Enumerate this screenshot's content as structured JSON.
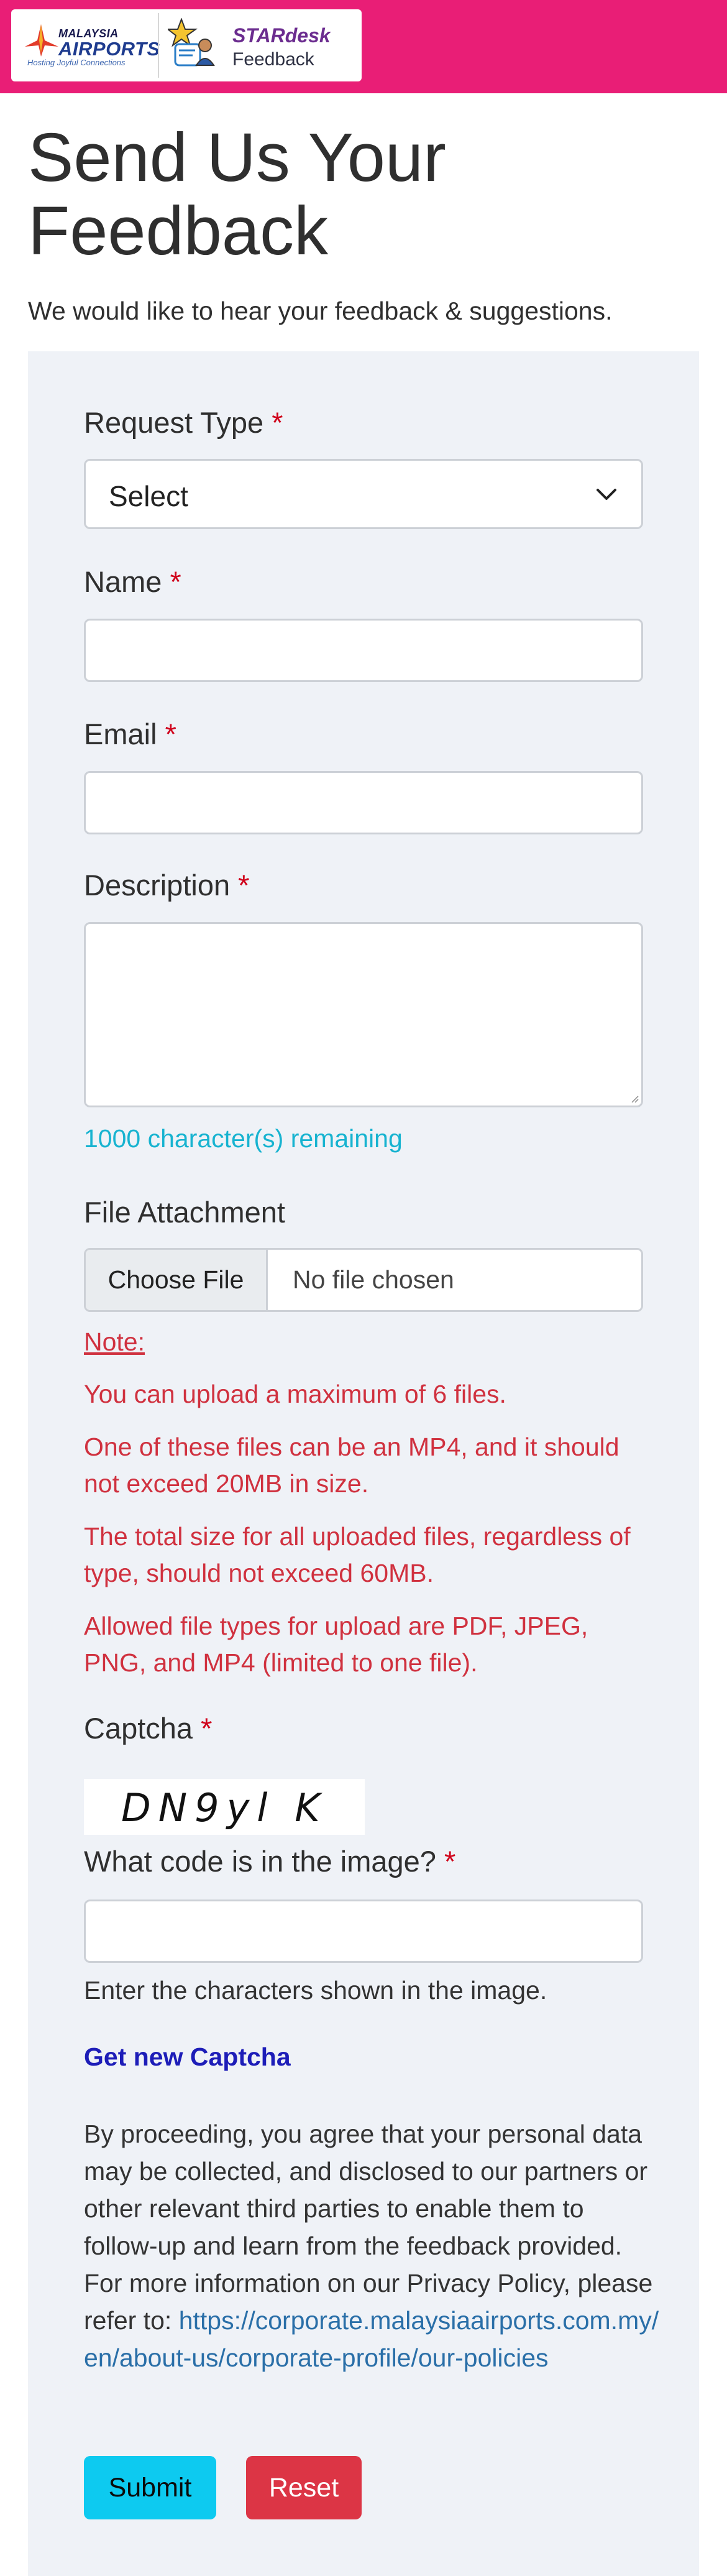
{
  "header": {
    "brand_line1": "MALAYSIA",
    "brand_line2": "AIRPORTS",
    "brand_tagline": "Hosting Joyful Connections",
    "product_title": "STARdesk",
    "product_subtitle": "Feedback",
    "bar_color": "#e91e76"
  },
  "page": {
    "title": "Send Us Your Feedback",
    "subtitle": "We would like to hear your feedback & suggestions."
  },
  "form": {
    "required_mark": "*",
    "request_type": {
      "label": "Request Type",
      "value": "Select"
    },
    "name": {
      "label": "Name",
      "value": ""
    },
    "email": {
      "label": "Email",
      "value": ""
    },
    "description": {
      "label": "Description",
      "value": "",
      "remaining": "1000 character(s) remaining"
    },
    "attachment": {
      "label": "File Attachment",
      "button": "Choose File",
      "status": "No file chosen"
    },
    "notes": {
      "heading": "Note:",
      "items": [
        "You can upload a maximum of 6 files.",
        "One of these files can be an MP4, and it should not exceed 20MB in size.",
        "The total size for all uploaded files, regardless of type, should not exceed 60MB.",
        "Allowed file types for upload are PDF, JPEG, PNG, and MP4 (limited to one file)."
      ]
    },
    "captcha": {
      "label": "Captcha",
      "image_text": "DN9yl K",
      "question": "What code is in the image?",
      "value": "",
      "helper": "Enter the characters shown in the image.",
      "refresh": "Get new Captcha"
    },
    "privacy": {
      "text": "By proceeding, you agree that your personal data may be collected, and disclosed to our partners or other relevant third parties to enable them to follow-up and learn from the feedback provided. For more information on our Privacy Policy, please refer to:",
      "link": "https://corporate.malaysiaairports.com.my/en/about-us/corporate-profile/our-policies"
    },
    "buttons": {
      "submit": "Submit",
      "reset": "Reset"
    }
  },
  "colors": {
    "required": "#d0021b",
    "note_text": "#d0313f",
    "remaining_text": "#17b3d0",
    "submit": "#0dcaf0",
    "reset": "#dc3545",
    "link": "#2a6fa8"
  }
}
